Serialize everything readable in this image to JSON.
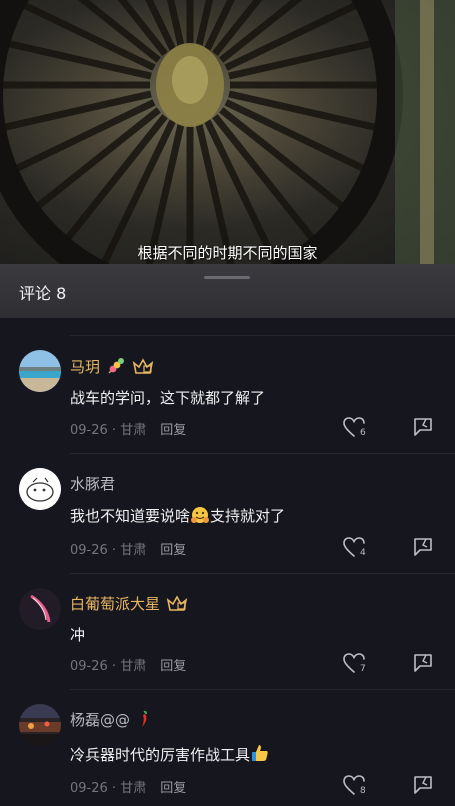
{
  "video": {
    "subtitle": "根据不同的时期不同的国家"
  },
  "comments_panel": {
    "title": "评论 8"
  },
  "comments": [
    {
      "username": "马玥",
      "username_color": "gold",
      "has_vip_badge": true,
      "emoji_after_name": "candied-hawthorn-emoji",
      "text": "战车的学问，这下就都了解了",
      "date": "09-26",
      "location": "甘肃",
      "reply_label": "回复",
      "likes": "6"
    },
    {
      "username": "水豚君",
      "username_color": "grey",
      "has_vip_badge": false,
      "text_before_emoji": "我也不知道要说啥",
      "text_emoji": "hugging-face-emoji",
      "text_after_emoji": "支持就对了",
      "date": "09-26",
      "location": "甘肃",
      "reply_label": "回复",
      "likes": "4"
    },
    {
      "username": "白葡萄派大星",
      "username_color": "gold",
      "has_vip_badge": true,
      "text": "冲",
      "date": "09-26",
      "location": "甘肃",
      "reply_label": "回复",
      "likes": "7"
    },
    {
      "username": "杨磊@@",
      "username_color": "grey",
      "has_vip_badge": false,
      "emoji_after_name": "chili-emoji",
      "text": "冷兵器时代的厉害作战工具",
      "text_emoji": "thumbs-up-emoji",
      "date": "09-26",
      "location": "甘肃",
      "reply_label": "回复",
      "likes": "8"
    }
  ],
  "meta_separator": " · ",
  "colors": {
    "background": "#16161e",
    "username_gold": "#e8b661",
    "meta": "#75757d"
  }
}
